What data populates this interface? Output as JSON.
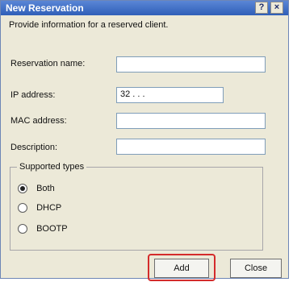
{
  "window": {
    "title": "New Reservation",
    "help_glyph": "?",
    "close_glyph": "×"
  },
  "description": "Provide information for a reserved client.",
  "form": {
    "reservation_name": {
      "label": "Reservation name:",
      "value": ""
    },
    "ip_address": {
      "label": "IP address:",
      "value": "32  .      .      ."
    },
    "mac_address": {
      "label": "MAC address:",
      "value": ""
    },
    "description": {
      "label": "Description:",
      "value": ""
    }
  },
  "supported_types": {
    "legend": "Supported types",
    "options": [
      {
        "label": "Both",
        "checked": true
      },
      {
        "label": "DHCP",
        "checked": false
      },
      {
        "label": "BOOTP",
        "checked": false
      }
    ]
  },
  "buttons": {
    "add": "Add",
    "close": "Close"
  },
  "colors": {
    "highlight": "#d42b2b",
    "titlebar": "#2f5fb8"
  }
}
